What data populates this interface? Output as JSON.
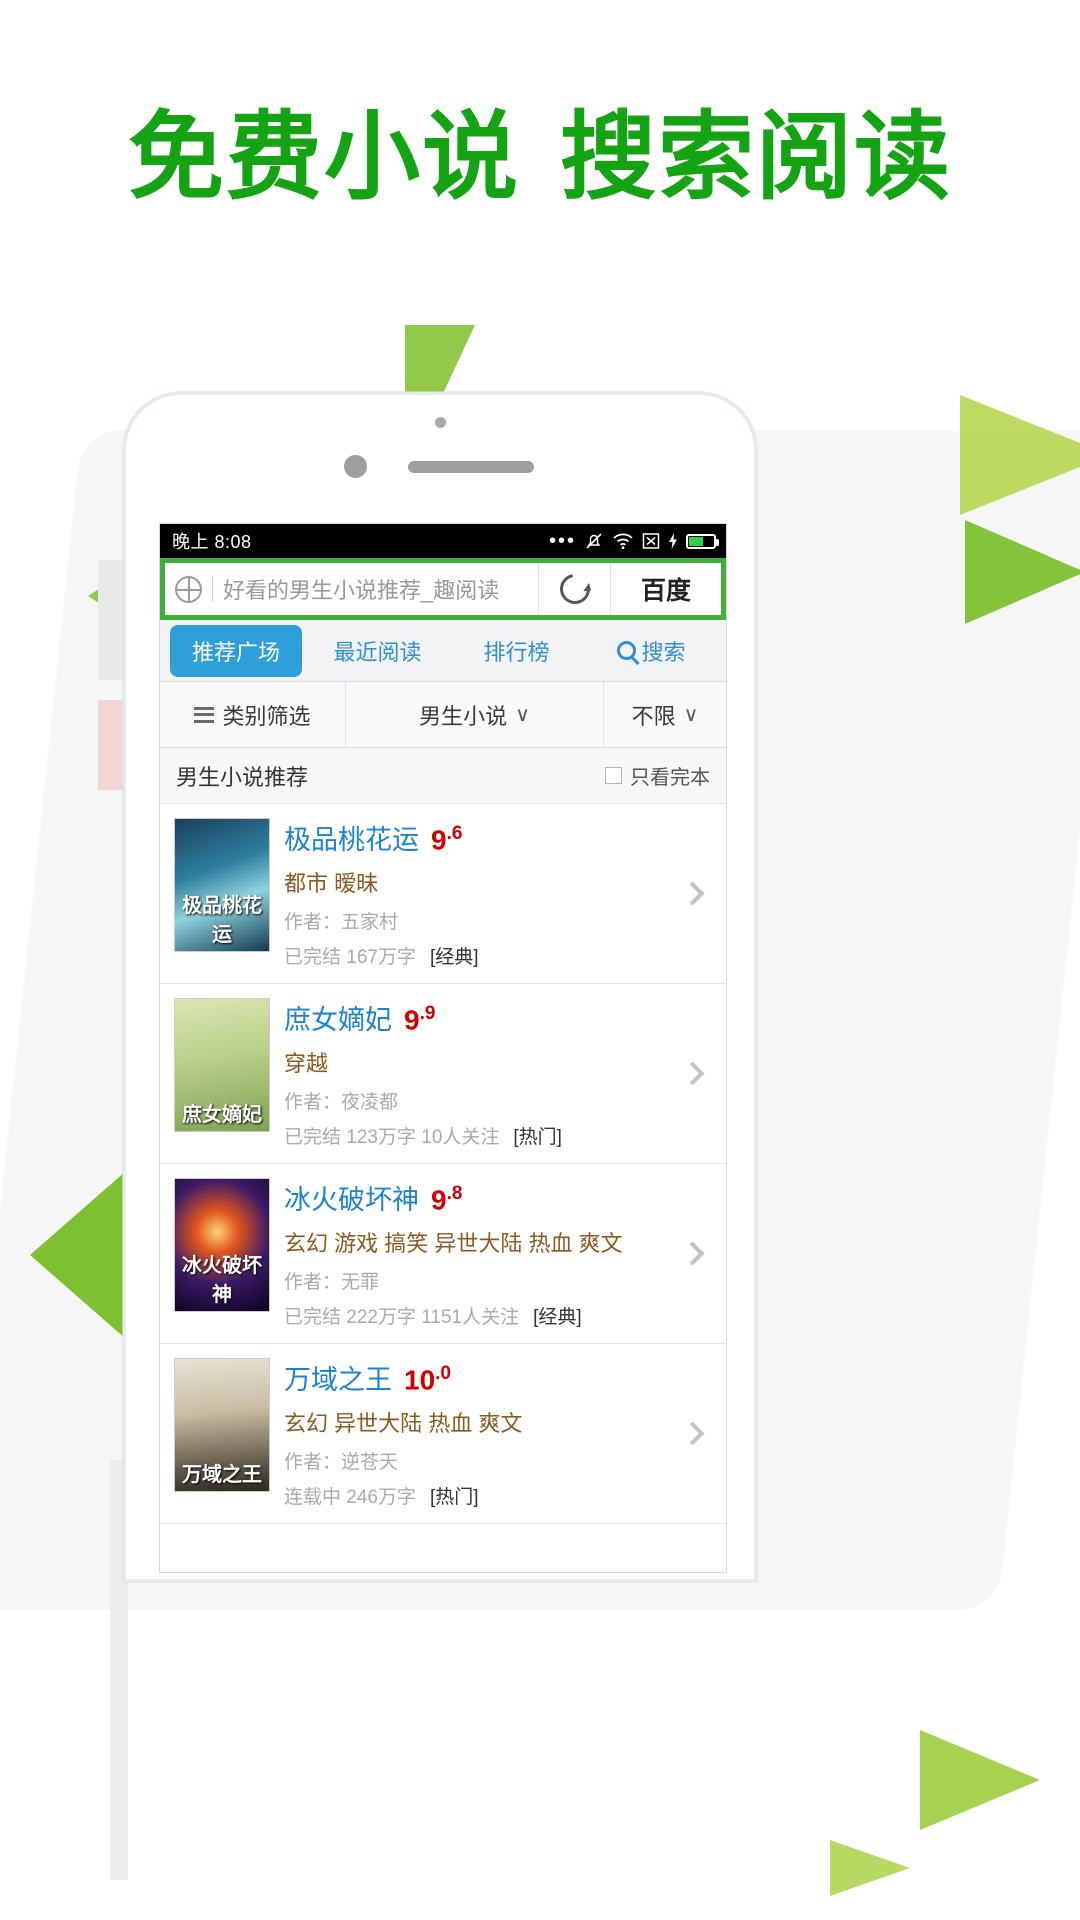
{
  "promo": {
    "headline_part1": "免费小说",
    "headline_part2": "搜索阅读"
  },
  "statusbar": {
    "time": "晚上 8:08",
    "icons": [
      "more-dots",
      "mute-bell",
      "wifi",
      "signal-x",
      "charging-bolt",
      "battery"
    ]
  },
  "browser": {
    "query": "好看的男生小说推荐_趣阅读",
    "refresh_label": "refresh",
    "brand": "百度"
  },
  "tabs": [
    {
      "label": "推荐广场",
      "active": true
    },
    {
      "label": "最近阅读",
      "active": false
    },
    {
      "label": "排行榜",
      "active": false
    },
    {
      "label": "搜索",
      "active": false,
      "icon": "search-icon"
    }
  ],
  "filters": [
    {
      "label": "类别筛选",
      "icon": "list-icon",
      "caret": ""
    },
    {
      "label": "男生小说",
      "caret": "∨"
    },
    {
      "label": "不限",
      "caret": "∨"
    }
  ],
  "section": {
    "title": "男生小说推荐",
    "only_complete_label": "只看完本",
    "only_complete_checked": false
  },
  "books": [
    {
      "title": "极品桃花运",
      "score_int": "9",
      "score_dec": ".6",
      "tags": "都市 暧昧",
      "author": "作者：五家村",
      "meta": "已完结 167万字",
      "badge": "[经典]",
      "cover_text": "极品桃花运",
      "cover_class": "c1"
    },
    {
      "title": "庶女嫡妃",
      "score_int": "9",
      "score_dec": ".9",
      "tags": "穿越",
      "author": "作者：夜凌都",
      "meta": "已完结 123万字 10人关注",
      "badge": "[热门]",
      "cover_text": "庶女嫡妃",
      "cover_class": "c2"
    },
    {
      "title": "冰火破坏神",
      "score_int": "9",
      "score_dec": ".8",
      "tags": "玄幻 游戏 搞笑 异世大陆 热血 爽文",
      "author": "作者：无罪",
      "meta": "已完结 222万字 1151人关注",
      "badge": "[经典]",
      "cover_text": "冰火破坏神",
      "cover_class": "c3"
    },
    {
      "title": "万域之王",
      "score_int": "10",
      "score_dec": ".0",
      "tags": "玄幻 异世大陆 热血 爽文",
      "author": "作者：逆苍天",
      "meta": "连载中 246万字",
      "badge": "[热门]",
      "cover_text": "万域之王",
      "cover_class": "c4"
    }
  ],
  "colors": {
    "brand_green": "#14a312",
    "searchbar_green": "#3fae3b",
    "tab_blue": "#2e9fd8",
    "title_blue": "#1e82d2",
    "score_red": "#d00000",
    "tag_brown": "#8a5a1e"
  }
}
